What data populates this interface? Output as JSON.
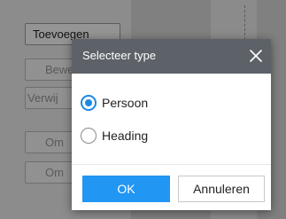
{
  "background": {
    "buttons": [
      {
        "label": "Toevoegen"
      },
      {
        "label": "Bewe"
      },
      {
        "label": "Verwij"
      },
      {
        "label": "Om"
      },
      {
        "label": "Om"
      }
    ]
  },
  "dialog": {
    "title": "Selecteer type",
    "close_icon": "close-icon",
    "options": [
      {
        "label": "Persoon",
        "selected": true
      },
      {
        "label": "Heading",
        "selected": false
      }
    ],
    "ok_label": "OK",
    "cancel_label": "Annuleren"
  },
  "colors": {
    "header": "#5c6267",
    "accent": "#2196f3"
  }
}
